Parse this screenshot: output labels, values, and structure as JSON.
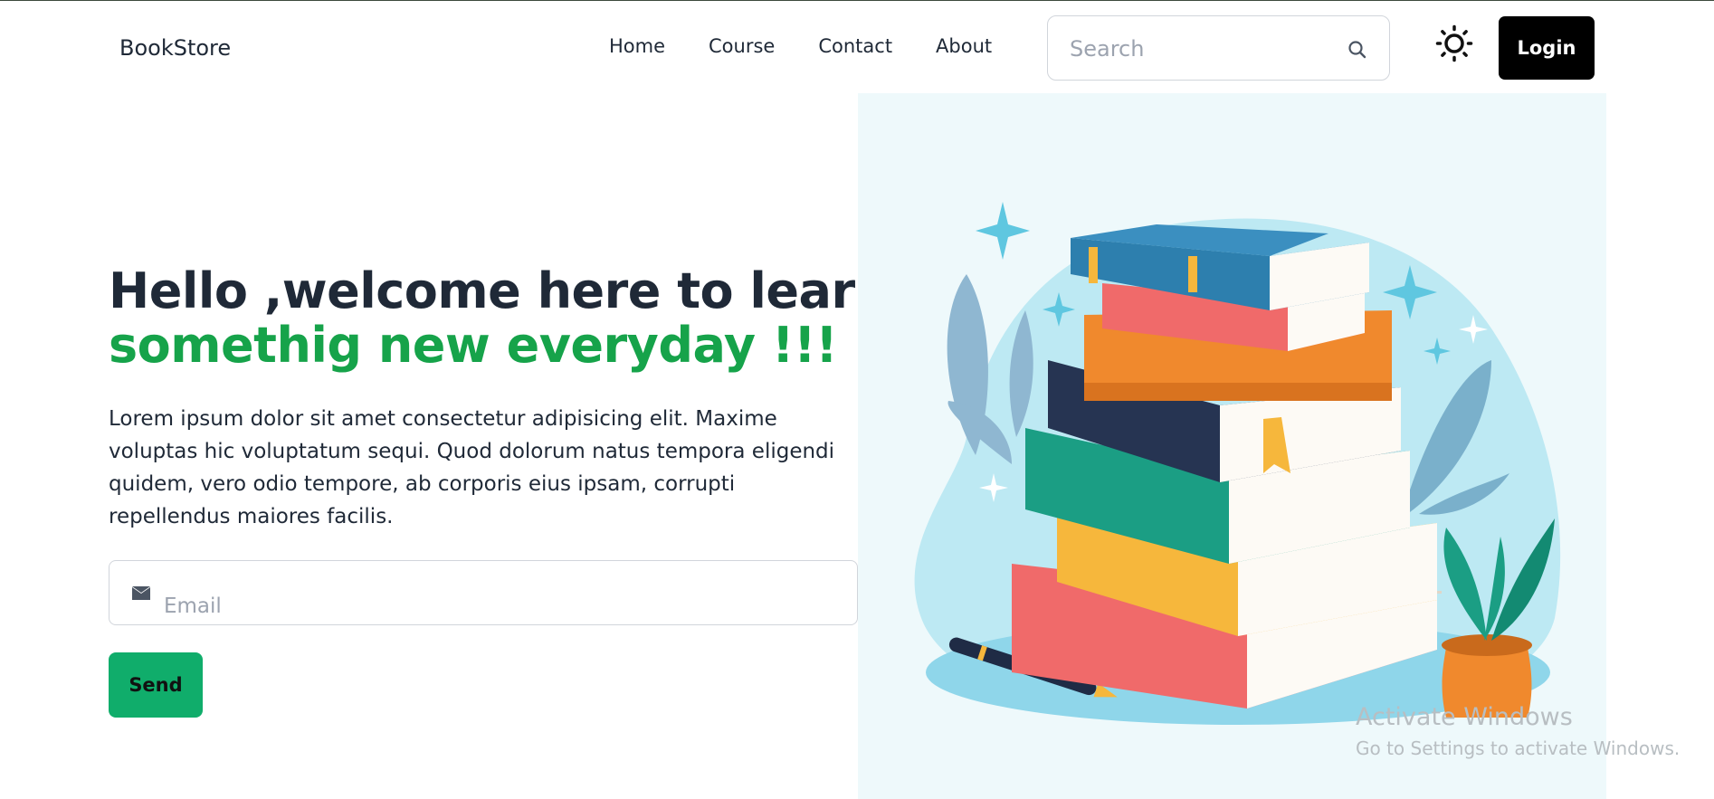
{
  "navbar": {
    "brand": "BookStore",
    "links": [
      {
        "label": "Home"
      },
      {
        "label": "Course"
      },
      {
        "label": "Contact"
      },
      {
        "label": "About"
      }
    ],
    "search": {
      "placeholder": "Search",
      "value": ""
    },
    "search_icon": "search-icon",
    "theme_icon": "sun-icon",
    "login_label": "Login"
  },
  "hero": {
    "title_line1": "Hello ,welcome here to learn",
    "title_line2": "somethig new everyday !!!",
    "description": "Lorem ipsum dolor sit amet consectetur adipisicing elit. Maxime voluptas hic voluptatum sequi. Quod dolorum natus tempora eligendi quidem, vero odio tempore, ab corporis eius ipsam, corrupti repellendus maiores facilis.",
    "email": {
      "placeholder": "Email",
      "value": ""
    },
    "email_icon": "envelope-icon",
    "send_label": "Send",
    "illustration": "stack-of-books-illustration"
  },
  "watermark": {
    "title": "Activate Windows",
    "subtitle": "Go to Settings to activate Windows."
  },
  "colors": {
    "accent_green": "#16a34a",
    "send_button": "#10ad6b",
    "login_button": "#000000",
    "illustration_bg": "#eef9fb"
  }
}
